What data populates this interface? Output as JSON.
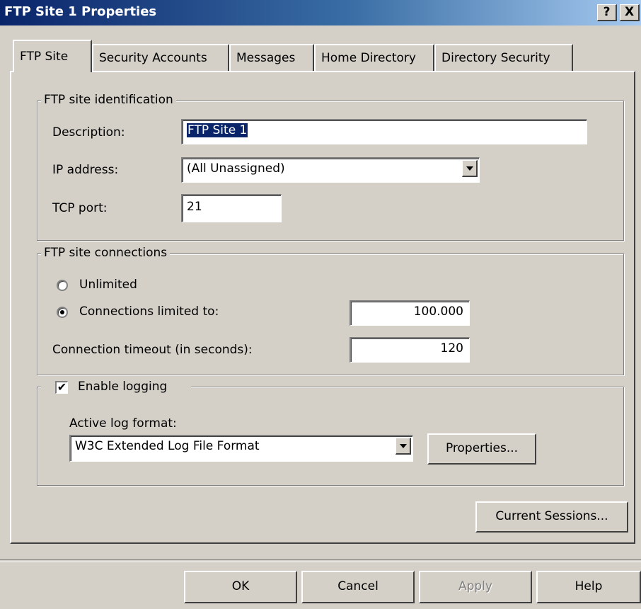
{
  "window": {
    "title": "FTP Site 1 Properties",
    "help_btn": "?",
    "close_btn": "X"
  },
  "tabs": [
    "FTP Site",
    "Security Accounts",
    "Messages",
    "Home Directory",
    "Directory Security"
  ],
  "identification": {
    "legend": "FTP site identification",
    "description_label": "Description:",
    "description_value": "FTP Site 1",
    "ip_label": "IP address:",
    "ip_value": "(All Unassigned)",
    "tcp_label": "TCP port:",
    "tcp_value": "21"
  },
  "connections": {
    "legend": "FTP site connections",
    "unlimited_label": "Unlimited",
    "limited_label": "Connections limited to:",
    "limited_value": "100.000",
    "timeout_label": "Connection timeout (in seconds):",
    "timeout_value": "120",
    "selected": "limited"
  },
  "logging": {
    "enable_label": "Enable logging",
    "enabled": true,
    "format_label": "Active log format:",
    "format_value": "W3C Extended Log File Format",
    "properties_button": "Properties..."
  },
  "current_sessions_button": "Current Sessions...",
  "footer": {
    "ok": "OK",
    "cancel": "Cancel",
    "apply": "Apply",
    "help": "Help"
  }
}
